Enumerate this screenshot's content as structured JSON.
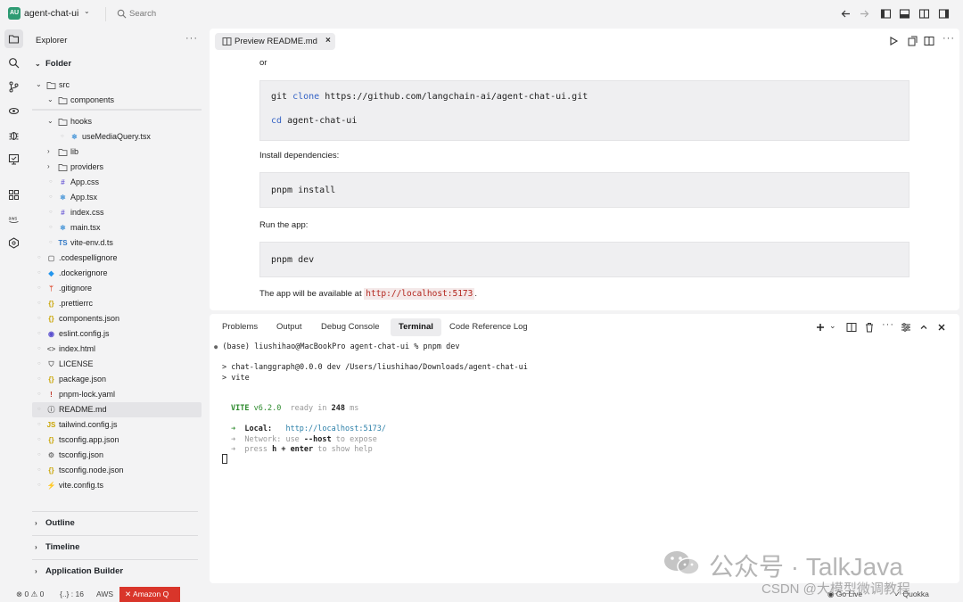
{
  "titlebar": {
    "badge": "AU",
    "app_name": "agent-chat-ui",
    "search_placeholder": "Search"
  },
  "explorer": {
    "title": "Explorer",
    "more": "···",
    "folder_header": "Folder",
    "tree": [
      {
        "name": "src",
        "type": "folder",
        "expanded": true
      },
      {
        "name": "components",
        "type": "folder",
        "expanded": true
      },
      {
        "name": "hooks",
        "type": "folder",
        "expanded": true
      },
      {
        "name": "useMediaQuery.tsx",
        "type": "react"
      },
      {
        "name": "lib",
        "type": "folder",
        "expanded": false
      },
      {
        "name": "providers",
        "type": "folder",
        "expanded": false
      },
      {
        "name": "App.css",
        "type": "css"
      },
      {
        "name": "App.tsx",
        "type": "react"
      },
      {
        "name": "index.css",
        "type": "css"
      },
      {
        "name": "main.tsx",
        "type": "react"
      },
      {
        "name": "vite-env.d.ts",
        "type": "ts"
      },
      {
        "name": ".codespellignore",
        "type": "file"
      },
      {
        "name": ".dockerignore",
        "type": "docker"
      },
      {
        "name": ".gitignore",
        "type": "git"
      },
      {
        "name": ".prettierrc",
        "type": "json"
      },
      {
        "name": "components.json",
        "type": "json"
      },
      {
        "name": "eslint.config.js",
        "type": "eslint"
      },
      {
        "name": "index.html",
        "type": "html"
      },
      {
        "name": "LICENSE",
        "type": "license"
      },
      {
        "name": "package.json",
        "type": "json"
      },
      {
        "name": "pnpm-lock.yaml",
        "type": "yaml"
      },
      {
        "name": "README.md",
        "type": "readme"
      },
      {
        "name": "tailwind.config.js",
        "type": "js"
      },
      {
        "name": "tsconfig.app.json",
        "type": "json"
      },
      {
        "name": "tsconfig.json",
        "type": "tsconfig"
      },
      {
        "name": "tsconfig.node.json",
        "type": "json"
      },
      {
        "name": "vite.config.ts",
        "type": "vite"
      }
    ],
    "sections": [
      "Outline",
      "Timeline",
      "Application Builder"
    ]
  },
  "editor": {
    "tab_label": "Preview README.md",
    "tab_close": "×",
    "or_text": "or",
    "code1_line1_a": "git ",
    "code1_line1_kw": "clone",
    "code1_line1_b": " https://github.com/langchain-ai/agent-chat-ui.git",
    "code1_line2_kw": "cd",
    "code1_line2_b": " agent-chat-ui",
    "install_label": "Install dependencies:",
    "code2": "pnpm install",
    "run_label": "Run the app:",
    "code3": "pnpm dev",
    "available_prefix": "The app will be available at ",
    "available_url": "http://localhost:5173",
    "available_suffix": "."
  },
  "panel": {
    "tabs": [
      "Problems",
      "Output",
      "Debug Console",
      "Terminal",
      "Code Reference Log"
    ],
    "active_tab": "Terminal",
    "terminal": {
      "prompt": "(base) liushihao@MacBookPro agent-chat-ui % pnpm dev",
      "line2": "> chat-langgraph@0.0.0 dev /Users/liushihao/Downloads/agent-chat-ui",
      "line3": "> vite",
      "vite_name": "VITE",
      "vite_version": " v6.2.0",
      "ready_text": "  ready in ",
      "ready_ms": "248",
      "ready_unit": " ms",
      "local_label": "Local:",
      "local_url": "http://localhost:5173/",
      "network_label": "Network:",
      "network_text": " use ",
      "network_flag": "--host",
      "network_suffix": " to expose",
      "press_text": "press ",
      "press_key": "h + enter",
      "press_suffix": " to show help",
      "arrow": "➜"
    }
  },
  "watermark": {
    "text": "公众号 · TalkJava",
    "csdn": "CSDN @大模型微调教程"
  },
  "statusbar": {
    "errors": "0",
    "warnings": "0",
    "braces": "{..} : 16",
    "aws": "AWS",
    "amazonq": "Amazon Q",
    "go_live": "Go Live",
    "quokka": "Quokka"
  },
  "colors": {
    "accent": "#2e9b73",
    "amazonq": "#d9352a",
    "keyword": "#3563c5",
    "inline_code": "#b3261e"
  }
}
